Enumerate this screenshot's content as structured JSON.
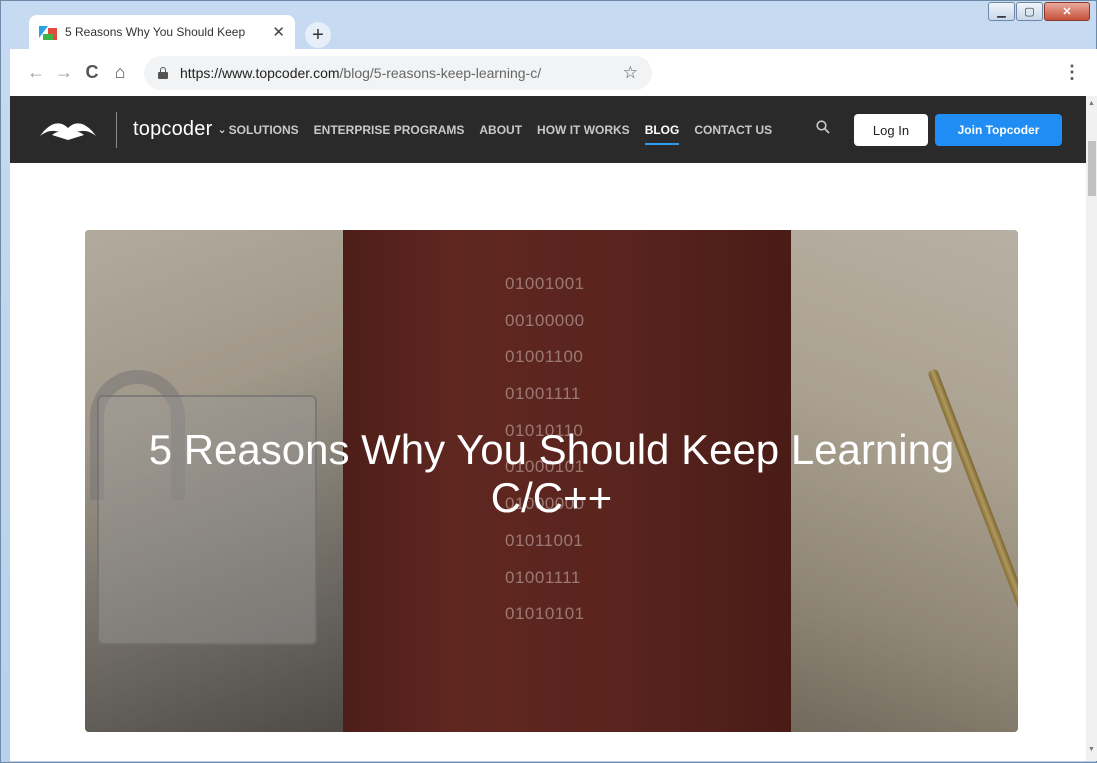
{
  "browser": {
    "tab_title": "5 Reasons Why You Should Keep",
    "tab_close": "✕",
    "new_tab": "+",
    "url_host": "https://www.topcoder.com",
    "url_path": "/blog/5-reasons-keep-learning-c/",
    "star": "☆",
    "menu": "⋮",
    "back": "←",
    "forward": "→",
    "reload": "C",
    "home": "⌂",
    "win_minimize": "▁",
    "win_restore": "▢",
    "win_close": "✕"
  },
  "header": {
    "logo_text": "topcoder",
    "caret": "⌄",
    "nav": [
      {
        "label": "SOLUTIONS"
      },
      {
        "label": "ENTERPRISE PROGRAMS"
      },
      {
        "label": "ABOUT"
      },
      {
        "label": "HOW IT WORKS"
      },
      {
        "label": "BLOG",
        "active": true
      },
      {
        "label": "CONTACT US"
      }
    ],
    "login_label": "Log In",
    "join_label": "Join Topcoder",
    "accent": "#1f8df4"
  },
  "hero": {
    "title": "5 Reasons Why You Should Keep Learning C/C++",
    "binary": [
      "01001001",
      "00100000",
      "01001100",
      "01001111",
      "01010110",
      "01000101",
      "01000000",
      "01011001",
      "01001111",
      "01010101"
    ]
  }
}
